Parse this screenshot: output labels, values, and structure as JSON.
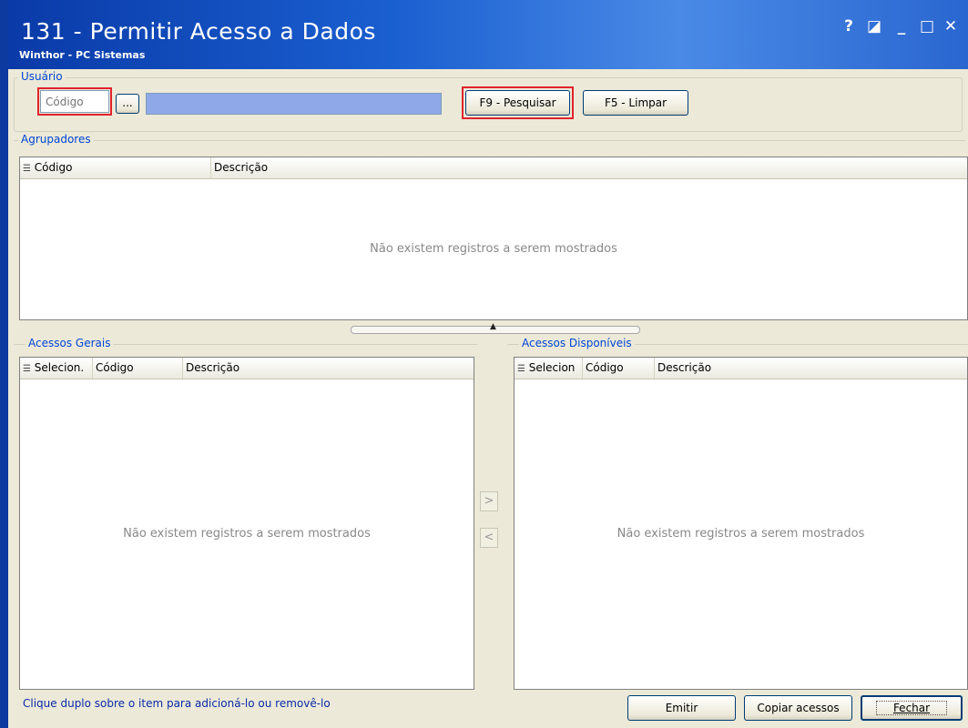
{
  "window": {
    "title": "131 - Permitir Acesso a Dados",
    "subtitle": "Winthor - PC Sistemas",
    "controls": {
      "help": "?",
      "restore": "◪",
      "minimize": "_",
      "maximize": "□",
      "close": "✕"
    }
  },
  "usuario": {
    "label": "Usuário",
    "codigo_placeholder": "Código",
    "codigo_value": "",
    "lookup_label": "...",
    "search_label": "F9 - Pesquisar",
    "clear_label": "F5 - Limpar"
  },
  "agrupadores": {
    "label": "Agrupadores",
    "columns": [
      "Código",
      "Descrição"
    ],
    "empty_text": "Não existem registros a serem mostrados"
  },
  "acessos_gerais": {
    "label": "Acessos Gerais",
    "columns": [
      "Selecion.",
      "Código",
      "Descrição"
    ],
    "empty_text": "Não existem registros a serem mostrados"
  },
  "acessos_disponiveis": {
    "label": "Acessos Disponíveis",
    "columns": [
      "Selecion",
      "Código",
      "Descrição"
    ],
    "empty_text": "Não existem registros a serem mostrados"
  },
  "transfer": {
    "add": ">",
    "remove": "<"
  },
  "footer": {
    "hint": "Clique duplo sobre o item para adicioná-lo ou removê-lo",
    "emit_label": "Emitir",
    "copy_label": "Copiar acessos",
    "close_label": "Fechar"
  },
  "colors": {
    "accent": "#0046d5",
    "highlight": "#e0232c",
    "title_bar": "#1a5fd0",
    "user_name_bar": "#8ea8e8"
  }
}
